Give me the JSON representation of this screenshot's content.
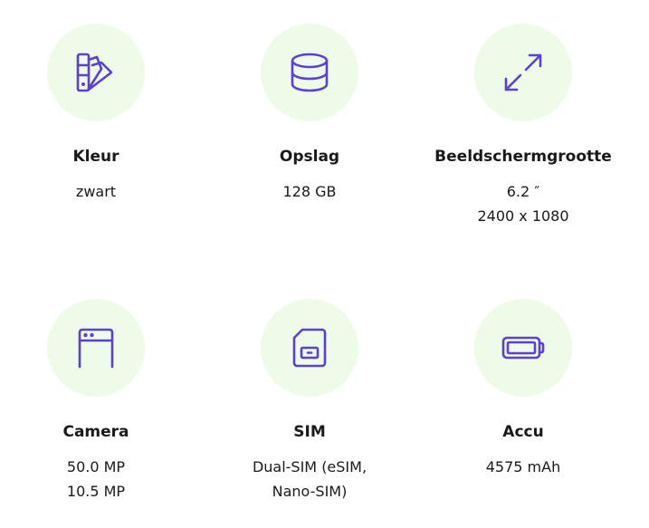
{
  "specs": [
    {
      "icon": "color-swatch-icon",
      "title": "Kleur",
      "values": [
        "zwart"
      ]
    },
    {
      "icon": "storage-database-icon",
      "title": "Opslag",
      "values": [
        "128 GB"
      ]
    },
    {
      "icon": "screen-size-expand-icon",
      "title": "Beeldschermgrootte",
      "values": [
        "6.2 ″",
        "2400 x 1080"
      ]
    },
    {
      "icon": "camera-phone-icon",
      "title": "Camera",
      "values": [
        "50.0 MP",
        "10.5 MP"
      ]
    },
    {
      "icon": "sim-card-icon",
      "title": "SIM",
      "values": [
        "Dual-SIM (eSIM,",
        "Nano-SIM)"
      ]
    },
    {
      "icon": "battery-icon",
      "title": "Accu",
      "values": [
        "4575 mAh"
      ]
    }
  ],
  "colors": {
    "icon_stroke": "#5b3fd6",
    "icon_background": "#effbe9",
    "text": "#1a1a1a"
  }
}
